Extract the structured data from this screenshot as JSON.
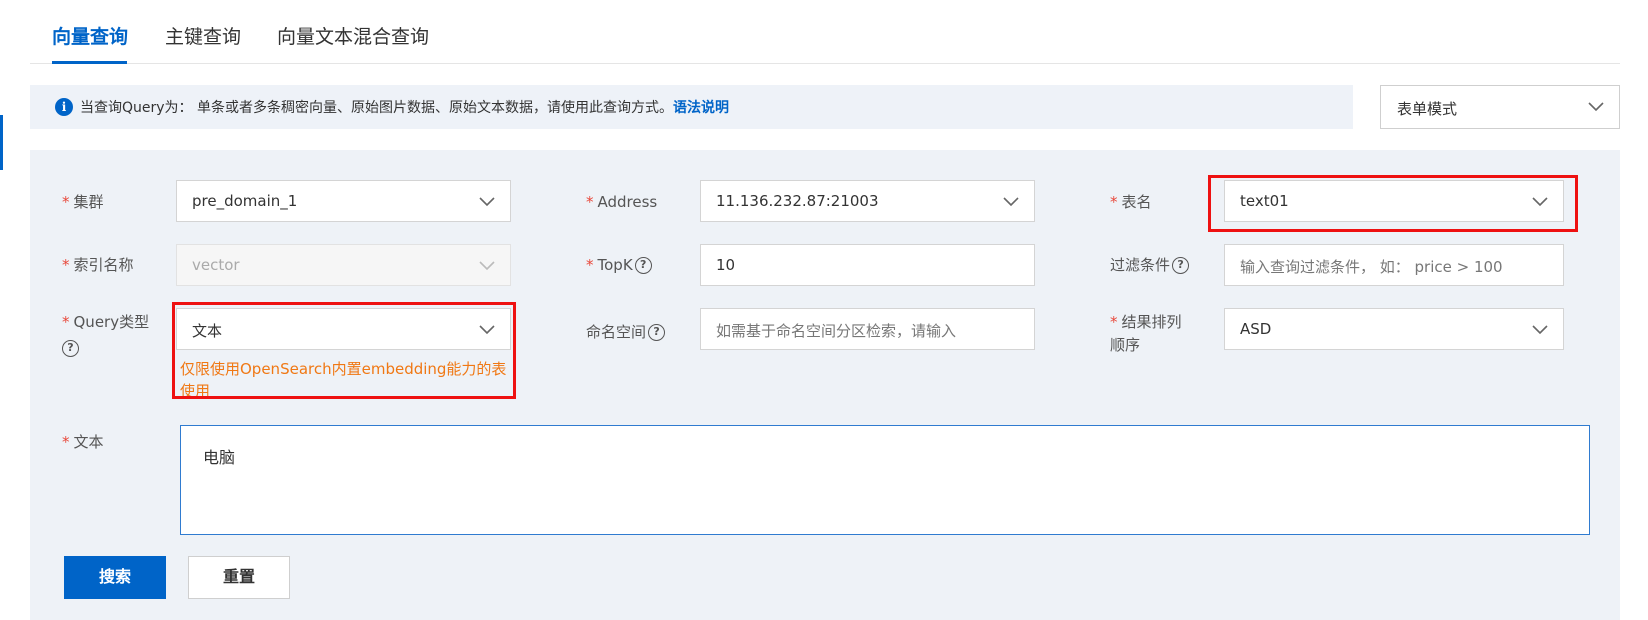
{
  "tabs": [
    {
      "label": "向量查询",
      "active": true
    },
    {
      "label": "主键查询",
      "active": false
    },
    {
      "label": "向量文本混合查询",
      "active": false
    }
  ],
  "info": {
    "text": "当查询Query为： 单条或者多条稠密向量、原始图片数据、原始文本数据，请使用此查询方式。",
    "link": "语法说明"
  },
  "mode_select": {
    "value": "表单模式"
  },
  "form": {
    "cluster": {
      "label": "集群",
      "value": "pre_domain_1"
    },
    "address": {
      "label": "Address",
      "value": "11.136.232.87:21003"
    },
    "table": {
      "label": "表名",
      "value": "text01"
    },
    "index": {
      "label": "索引名称",
      "value": "vector"
    },
    "topk": {
      "label": "TopK",
      "value": "10"
    },
    "filter": {
      "label": "过滤条件",
      "placeholder": "输入查询过滤条件， 如： price > 100"
    },
    "query_type": {
      "label": "Query类型",
      "value": "文本",
      "hint": "仅限使用OpenSearch内置embedding能力的表使用"
    },
    "namespace": {
      "label": "命名空间",
      "placeholder": "如需基于命名空间分区检索，请输入"
    },
    "sort": {
      "label_line1": "结果排列",
      "label_line2": "顺序",
      "value": "ASD"
    },
    "text": {
      "label": "文本",
      "value": "电脑"
    }
  },
  "buttons": {
    "search": "搜索",
    "reset": "重置"
  },
  "colors": {
    "accent": "#0064c8",
    "highlight_box": "#ee1111",
    "hint": "#f07814",
    "required": "#e8483b"
  }
}
